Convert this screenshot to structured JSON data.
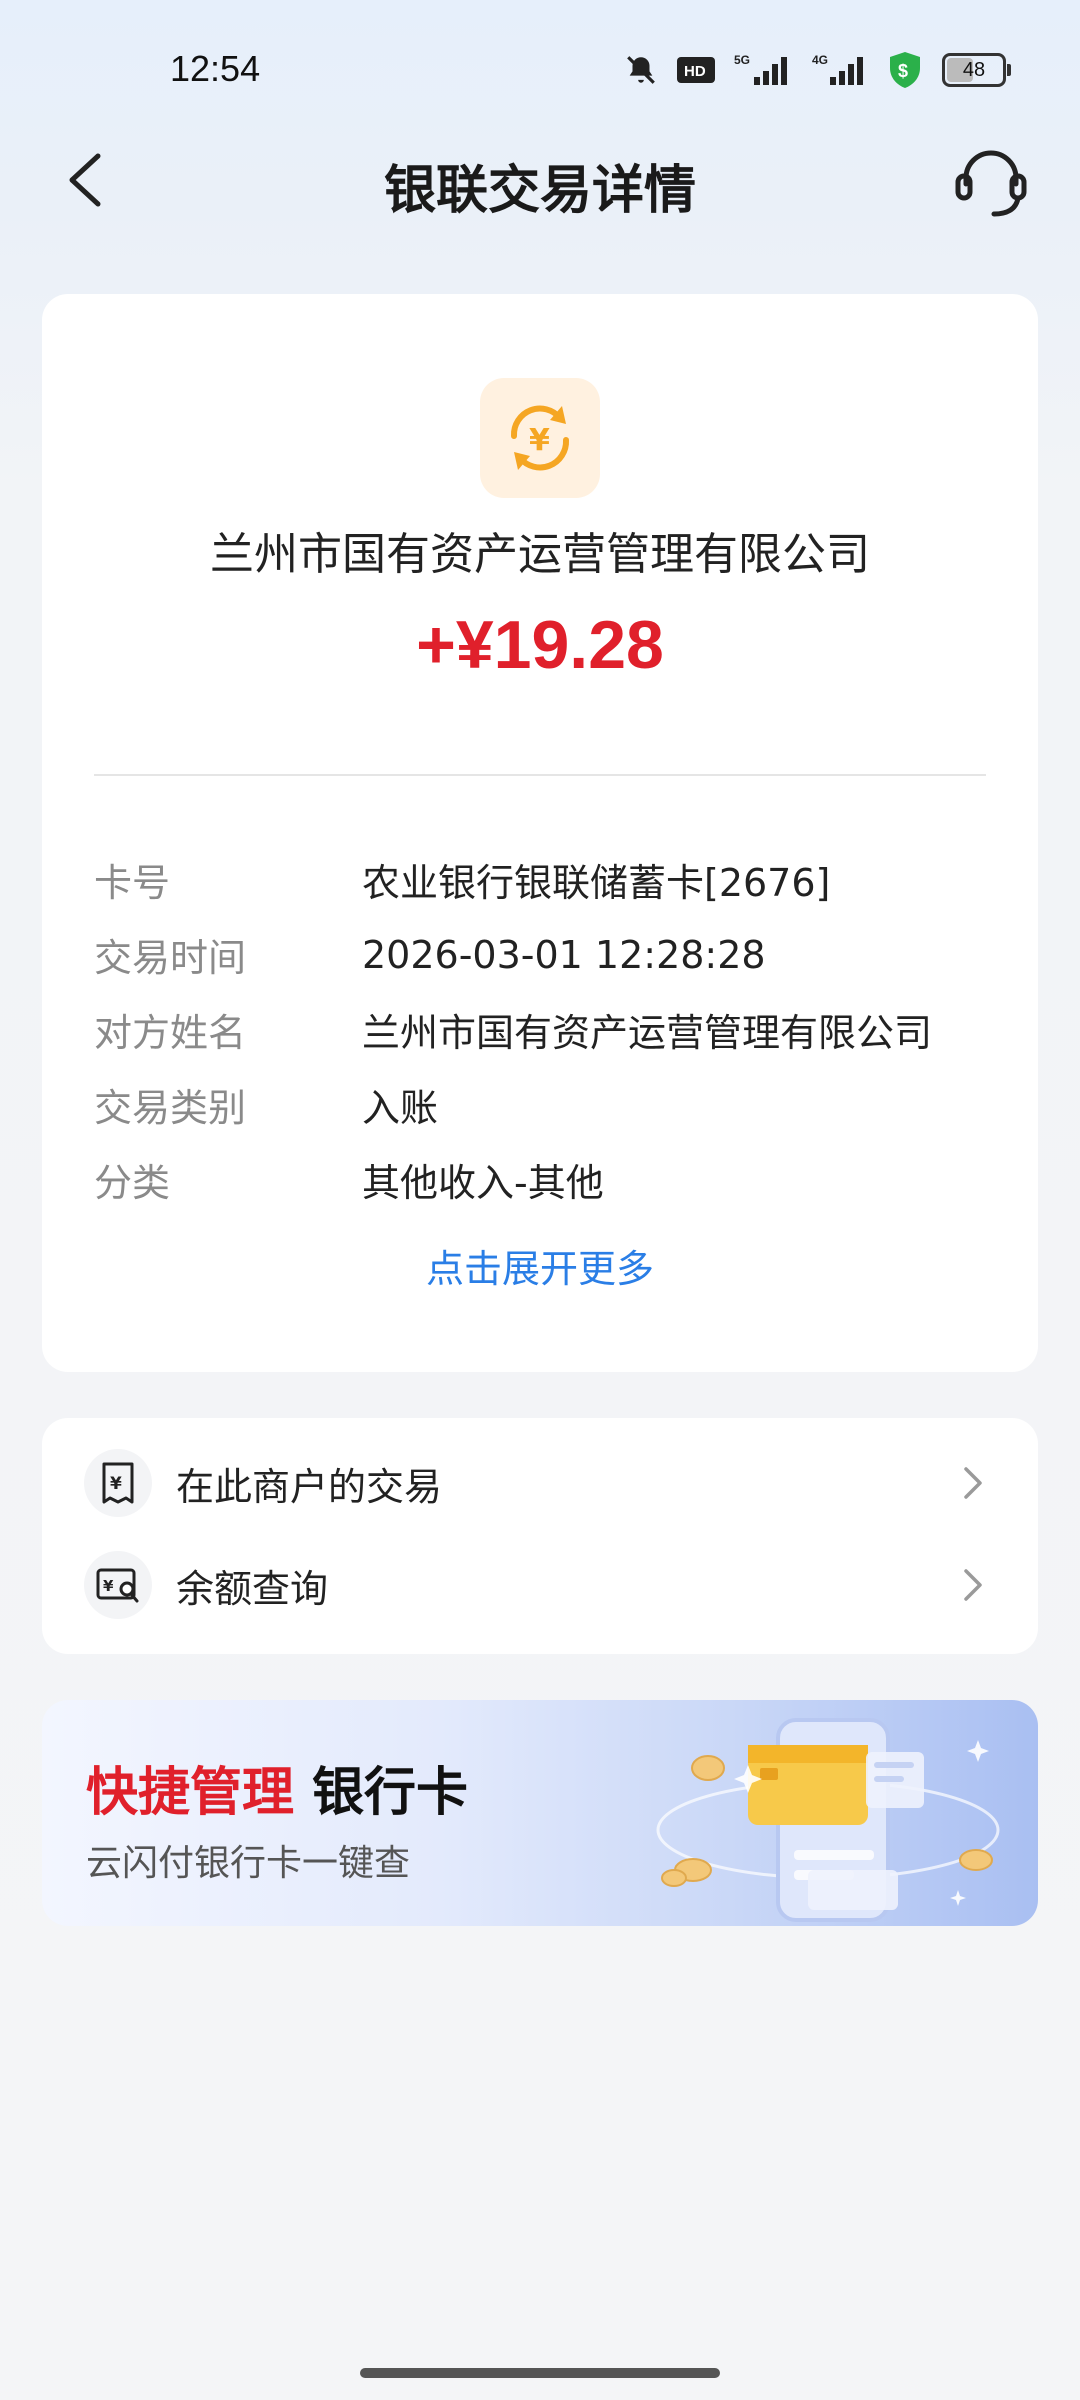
{
  "status_bar": {
    "time": "12:54",
    "icons": [
      "bell-muted-icon",
      "hd-icon",
      "signal-5g-icon",
      "signal-4g-icon",
      "security-shield-icon"
    ],
    "battery": "48"
  },
  "header": {
    "title": "银联交易详情"
  },
  "transaction": {
    "merchant": "兰州市国有资产运营管理有限公司",
    "amount": "+¥19.28",
    "details": [
      {
        "label": "卡号",
        "value": "农业银行银联储蓄卡[2676]"
      },
      {
        "label": "交易时间",
        "value": "2026-03-01 12:28:28"
      },
      {
        "label": "对方姓名",
        "value": "兰州市国有资产运营管理有限公司"
      },
      {
        "label": "交易类别",
        "value": "入账"
      },
      {
        "label": "分类",
        "value": "其他收入-其他"
      }
    ],
    "expand_label": "点击展开更多"
  },
  "actions": [
    {
      "label": "在此商户的交易",
      "icon": "receipt-yuan-icon"
    },
    {
      "label": "余额查询",
      "icon": "balance-search-icon"
    }
  ],
  "banner": {
    "title_red": "快捷管理",
    "title_dark": "银行卡",
    "subtitle": "云闪付银行卡一键查"
  },
  "colors": {
    "amount": "#e0202b",
    "link": "#2a7ee6",
    "logo_bg": "#fff1e0",
    "logo_icon": "#f5a623"
  }
}
